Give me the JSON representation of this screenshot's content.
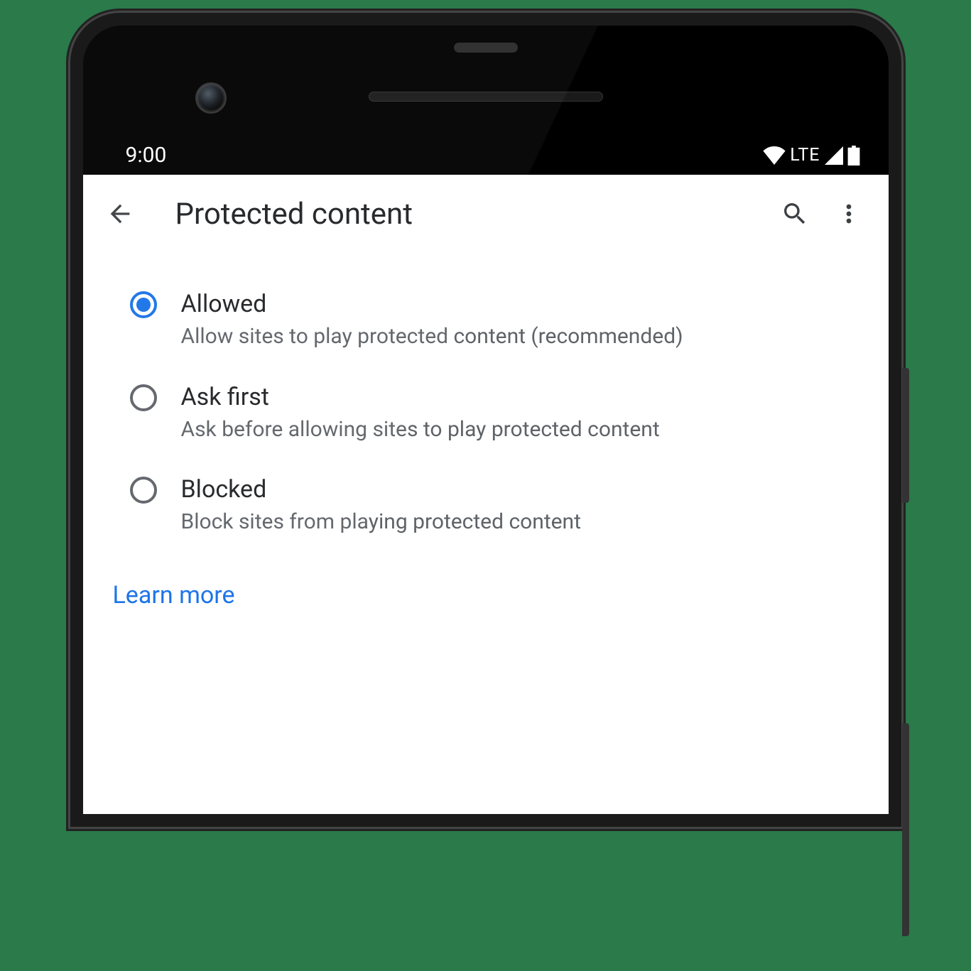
{
  "statusbar": {
    "time": "9:00",
    "network": "LTE"
  },
  "appbar": {
    "title": "Protected content"
  },
  "options": [
    {
      "title": "Allowed",
      "description": "Allow sites to play protected content (recommended)",
      "selected": true
    },
    {
      "title": "Ask first",
      "description": "Ask before allowing sites to play protected content",
      "selected": false
    },
    {
      "title": "Blocked",
      "description": "Block sites from playing protected content",
      "selected": false
    }
  ],
  "footer": {
    "learn_more": "Learn more"
  }
}
